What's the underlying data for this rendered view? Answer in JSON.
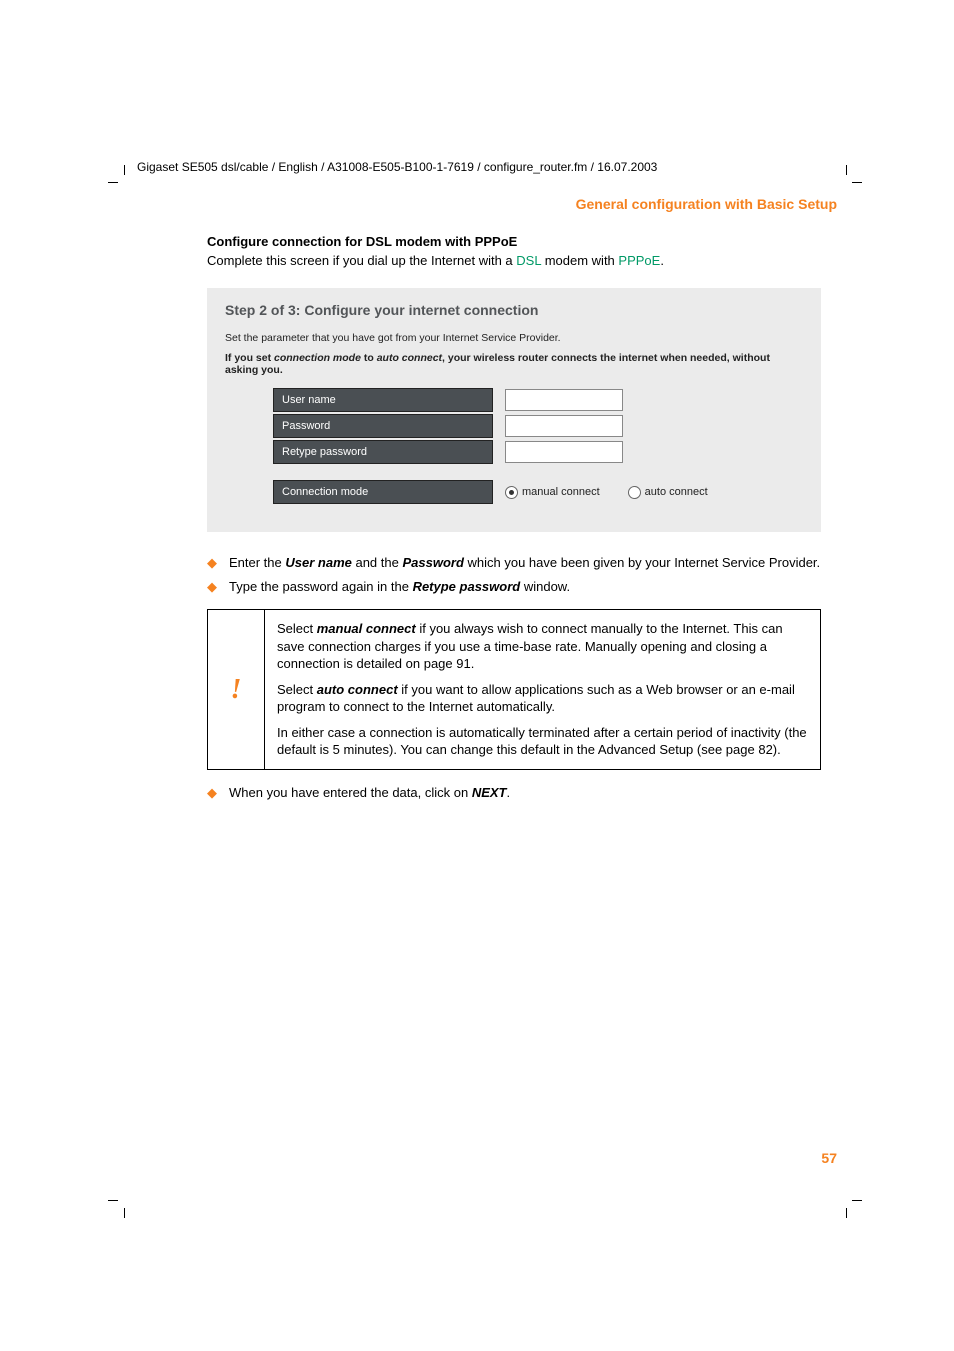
{
  "header": {
    "path": "Gigaset SE505 dsl/cable / English / A31008-E505-B100-1-7619 / configure_router.fm / 16.07.2003"
  },
  "section_title": "General configuration with Basic Setup",
  "config": {
    "heading": "Configure connection for DSL modem with PPPoE",
    "intro_pre": "Complete this screen if you dial up the Internet with a ",
    "intro_link1": "DSL",
    "intro_mid": " modem with ",
    "intro_link2": "PPPoE",
    "intro_post": "."
  },
  "screenshot": {
    "title": "Step 2 of 3: Configure your internet connection",
    "line1": "Set the parameter that you have got from your Internet Service Provider.",
    "line2_pre": "If you set ",
    "line2_em1": "connection mode",
    "line2_mid": " to ",
    "line2_em2": "auto connect",
    "line2_post": ", your wireless router connects the internet when needed, without asking you.",
    "labels": {
      "user": "User name",
      "pass": "Password",
      "retype": "Retype password",
      "mode": "Connection mode"
    },
    "values": {
      "user": "",
      "pass": "",
      "retype": ""
    },
    "radios": {
      "manual": "manual connect",
      "auto": "auto connect"
    }
  },
  "bullets": {
    "b1_pre": "Enter the ",
    "b1_bold1": "User name",
    "b1_mid": " and the ",
    "b1_bold2": "Password",
    "b1_post": " which you have been given by your Internet Service Provider.",
    "b2_pre": "Type the password again in the ",
    "b2_bold": "Retype password",
    "b2_post": " window."
  },
  "note": {
    "icon": "!",
    "p1_pre": "Select ",
    "p1_bold": "manual connect",
    "p1_post": " if you always wish to connect manually to the Internet. This can save connection charges if you use a time-base rate. Manually opening and closing a connection is detailed on page 91.",
    "p2_pre": "Select ",
    "p2_bold": "auto connect",
    "p2_post": " if you want to allow applications such as a Web browser or an e-mail program to connect to the Internet automatically.",
    "p3": "In either case a connection is automatically terminated after a certain period of inactivity (the default is 5 minutes). You can change this default in the Advanced Setup (see page 82)."
  },
  "bullets2": {
    "b3_pre": "When you have entered the data, click on ",
    "b3_bold": "NEXT",
    "b3_post": "."
  },
  "page_number": "57"
}
